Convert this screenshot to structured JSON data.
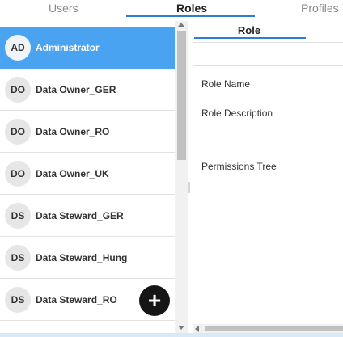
{
  "tabs": {
    "users": "Users",
    "roles": "Roles",
    "profiles": "Profiles"
  },
  "roles": [
    {
      "initials": "AD",
      "name": "Administrator",
      "selected": true
    },
    {
      "initials": "DO",
      "name": "Data Owner_GER"
    },
    {
      "initials": "DO",
      "name": "Data Owner_RO"
    },
    {
      "initials": "DO",
      "name": "Data Owner_UK"
    },
    {
      "initials": "DS",
      "name": "Data Steward_GER"
    },
    {
      "initials": "DS",
      "name": "Data Steward_Hung"
    },
    {
      "initials": "DS",
      "name": "Data Steward_RO"
    }
  ],
  "fab": {
    "icon": "plus-icon",
    "glyph": "+"
  },
  "detail": {
    "tab": "Role",
    "fields": {
      "role_name": "Role Name",
      "role_description": "Role Description",
      "permissions_tree": "Permissions Tree"
    }
  },
  "colors": {
    "accent": "#2a7fd4",
    "selected_bg": "#4aa3f0",
    "fab_bg": "#151515"
  }
}
